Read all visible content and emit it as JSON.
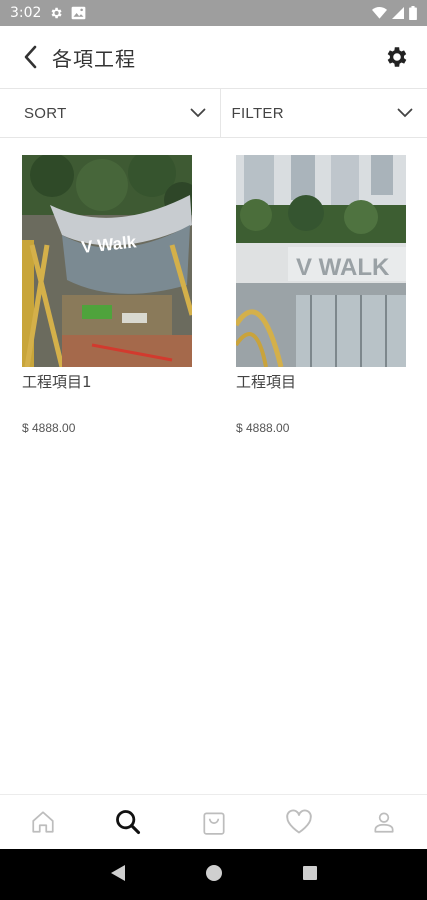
{
  "status_bar": {
    "time": "3:02"
  },
  "header": {
    "title": "各項工程"
  },
  "toolbar": {
    "sort_label": "SORT",
    "filter_label": "FILTER"
  },
  "products": [
    {
      "title": "工程項目1",
      "price": "$ 4888.00",
      "image_text": "V Walk"
    },
    {
      "title": "工程項目",
      "price": "$ 4888.00",
      "image_text": "V WALK"
    }
  ],
  "colors": {
    "status_bar": "#9e9e9e",
    "icon_inactive": "#bdbdbd",
    "icon_active": "#111111"
  }
}
